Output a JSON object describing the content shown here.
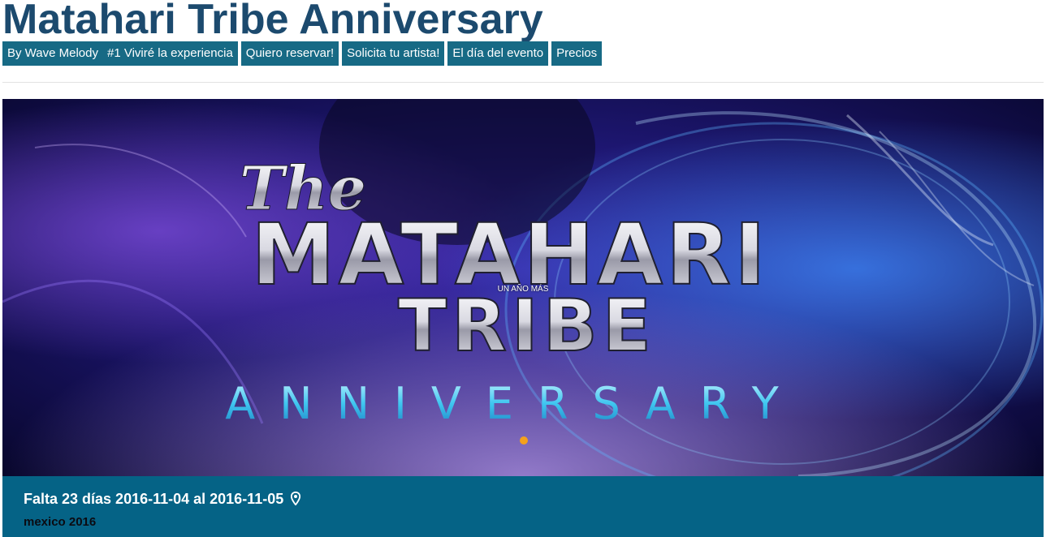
{
  "page": {
    "title": "Matahari Tribe Anniversary"
  },
  "nav": {
    "items": [
      {
        "label": "By Wave Melody"
      },
      {
        "label": "#1 Viviré la experiencia"
      },
      {
        "label": "Quiero reservar!"
      },
      {
        "label": "Solicita tu artista!"
      },
      {
        "label": "El día del evento"
      },
      {
        "label": "Precios"
      }
    ]
  },
  "banner": {
    "logo_script": "The",
    "logo_line1": "MATAHARI",
    "logo_line2": "TRIBE",
    "logo_line3": "ANNIVERSARY",
    "caption": "UN AÑO MÁS",
    "slide_count": 1,
    "active_slide": 1
  },
  "event": {
    "dates_text": "Falta 23 días 2016-11-04 al 2016-11-05",
    "location_text": "mexico 2016",
    "location_icon": "map-marker-icon"
  },
  "colors": {
    "title": "#1c4a6e",
    "nav_bg": "#176a85",
    "info_bar_bg": "#056386",
    "slide_dot": "#f4a11c"
  }
}
